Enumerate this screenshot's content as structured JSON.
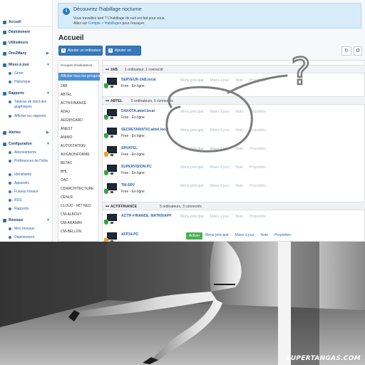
{
  "sidebar": {
    "items": [
      {
        "label": "Accueil",
        "kind": "top",
        "chevron": false
      },
      {
        "label": "Déploiement",
        "kind": "top",
        "chevron": false
      },
      {
        "label": "Utilisateurs",
        "kind": "top",
        "chevron": false
      },
      {
        "label": "One2Many",
        "kind": "top",
        "chevron": true
      },
      {
        "label": "Mises à jour",
        "kind": "top",
        "chevron": true
      },
      {
        "label": "Gérer",
        "kind": "sub"
      },
      {
        "label": "Historique",
        "kind": "sub"
      },
      {
        "label": "Rapports",
        "kind": "top",
        "chevron": true
      },
      {
        "label": "Tableau de bord des graphiques",
        "kind": "sub"
      },
      {
        "label": "Afficher les rapports",
        "kind": "sub"
      },
      {
        "label": "Alertes",
        "kind": "top",
        "chevron": true
      },
      {
        "label": "Configuration",
        "kind": "top",
        "chevron": true
      },
      {
        "label": "Abonnements",
        "kind": "sub"
      },
      {
        "label": "Préférences de l'hôte",
        "kind": "sub"
      },
      {
        "label": "Identifiants",
        "kind": "sub"
      },
      {
        "label": "Appareils",
        "kind": "sub"
      },
      {
        "label": "Fuseau horaire",
        "kind": "sub"
      },
      {
        "label": "RSS",
        "kind": "sub"
      },
      {
        "label": "Rapports",
        "kind": "sub"
      },
      {
        "label": "Réseaux",
        "kind": "top",
        "chevron": true
      },
      {
        "label": "Mes réseaux",
        "kind": "sub"
      },
      {
        "label": "Déploiement",
        "kind": "sub"
      }
    ]
  },
  "banner": {
    "title": "Découvrez l'habillage nocturne",
    "line1": "Vous travaillez tard ? L'habillage de nuit est fait pour vous.",
    "line2_prefix": "Allez sur",
    "line2_link": "Compte > Habillages",
    "line2_suffix": "pour l'essayer."
  },
  "page": {
    "title": "Accueil",
    "add_computer": "Ajouter un ordinateur",
    "add_group": "Ajouter un groupe",
    "refresh_icon": "↻",
    "settings_icon": "⚙"
  },
  "groups_panel": {
    "header": "Groupes d'ordinateurs",
    "selected": "Afficher tous les groupes",
    "items": [
      "2AB",
      "ABTEL",
      "ACTIFFINANCE",
      "ADAJ",
      "AEGIPICARD",
      "ANEST",
      "ANIMO",
      "AUTOSTATION",
      "AVIGNONFORME",
      "BETAC",
      "BHL",
      "CAC",
      "CDARCHITECTURE",
      "CENLR",
      "CLOUD - MIT NEO",
      "CM-ALBOUY",
      "CM-ARAMAV",
      "CM-BELLON"
    ]
  },
  "groups": [
    {
      "name": "2AB",
      "summary": "1 ordinateur, 1 connecté"
    },
    {
      "name": "ABTEL",
      "summary": "5 ordinateurs, 5 connectés"
    },
    {
      "name": "ACTIFFINANCE",
      "summary": "5 ordinateurs, 3 connectés"
    }
  ],
  "computers": [
    {
      "name": "SERVEUR-2AB.local",
      "status": "Free - En ligne",
      "shield": "green"
    },
    {
      "name": "DAKOTA.abtel.local",
      "status": "Free - En ligne",
      "shield": "green"
    },
    {
      "name": "SECRETARIAT01.abtel.local",
      "status": "Free - En ligne",
      "shield": "green"
    },
    {
      "name": "SRVATEL",
      "status": "Free - En ligne",
      "shield": "orange"
    },
    {
      "name": "SUPERVISION-PC",
      "status": "Free - En ligne",
      "shield": "green"
    },
    {
      "name": "TM-SRV",
      "status": "Free - En ligne",
      "shield": "green"
    },
    {
      "name": "ACTIF-FINANCE_MATRIXAPP",
      "status": "",
      "shield": "green"
    },
    {
      "name": "AFP14-PC",
      "status": "",
      "shield": "orange"
    }
  ],
  "actions": {
    "menu": "Menu principal",
    "updates": "Mises à jour",
    "note": "Note",
    "props": "Propriétés",
    "activate": "Activer"
  },
  "annotation": {
    "mark": "?"
  },
  "photo": {
    "watermark": "SUPERTANGAS.COM"
  }
}
